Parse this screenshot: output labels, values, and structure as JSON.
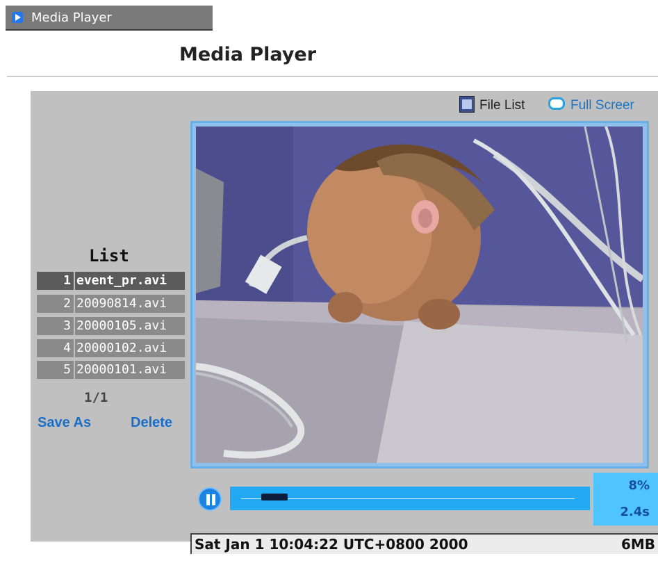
{
  "header": {
    "tab_label": "Media Player",
    "page_title": "Media Player"
  },
  "toolbar": {
    "file_list_label": "File List",
    "full_screen_label": "Full Screer"
  },
  "list": {
    "title": "List",
    "items": [
      {
        "index": "1",
        "name": "event_pr.avi",
        "selected": true
      },
      {
        "index": "2",
        "name": "20090814.avi",
        "selected": false
      },
      {
        "index": "3",
        "name": "20000105.avi",
        "selected": false
      },
      {
        "index": "4",
        "name": "20000102.avi",
        "selected": false
      },
      {
        "index": "5",
        "name": "20000101.avi",
        "selected": false
      }
    ],
    "pager": "1/1",
    "save_as_label": "Save As",
    "delete_label": "Delete"
  },
  "player": {
    "progress_percent": "8%",
    "elapsed": "2.4s",
    "progress_fraction": 0.08,
    "state": "playing"
  },
  "status": {
    "datetime": "Sat Jan 1 10:04:22 UTC+0800 2000",
    "file_size": "6MB"
  },
  "colors": {
    "accent": "#23a8f2",
    "link": "#1b6ec8",
    "panel": "#c0c0c0"
  },
  "icons": {
    "tab": "play-triangle-icon",
    "file_list": "sd-card-icon",
    "full_screen": "full-screen-icon",
    "pause": "pause-icon"
  }
}
